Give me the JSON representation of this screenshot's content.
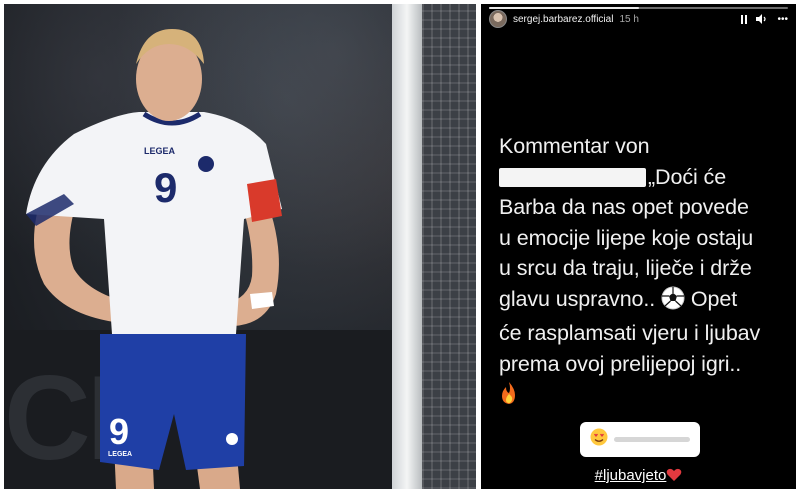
{
  "photo": {
    "jersey_number": "9",
    "jersey_brand": "LEGEA",
    "board_text": "CI"
  },
  "story": {
    "progress": 0.5,
    "username": "sergej.barbarez.official",
    "time": "15 h",
    "more_glyph": "•••",
    "comment_lines": [
      "Kommentar von",
      "„Doći će",
      "Barba da nas opet povede",
      "u emocije lijepe koje ostaju",
      "u srcu da traju, liječe i drže",
      "glavu uspravno..",
      "Opet",
      "će rasplamsati vjeru i ljubav",
      "prema ovoj prelijepoj igri.."
    ],
    "slider": {
      "emoji": "heart-eyes-emoji",
      "value": 0.0
    },
    "hashtag": "#ljubavjeto"
  },
  "colors": {
    "story_bg": "#000000",
    "text": "#f0f0f0",
    "jersey_white": "#f3f4f7",
    "jersey_navy": "#1c2a6b",
    "shorts_blue": "#1f3fa6",
    "captain_band": "#d93a2b",
    "fire": "#f36b1c",
    "heart": "#e2393f"
  }
}
